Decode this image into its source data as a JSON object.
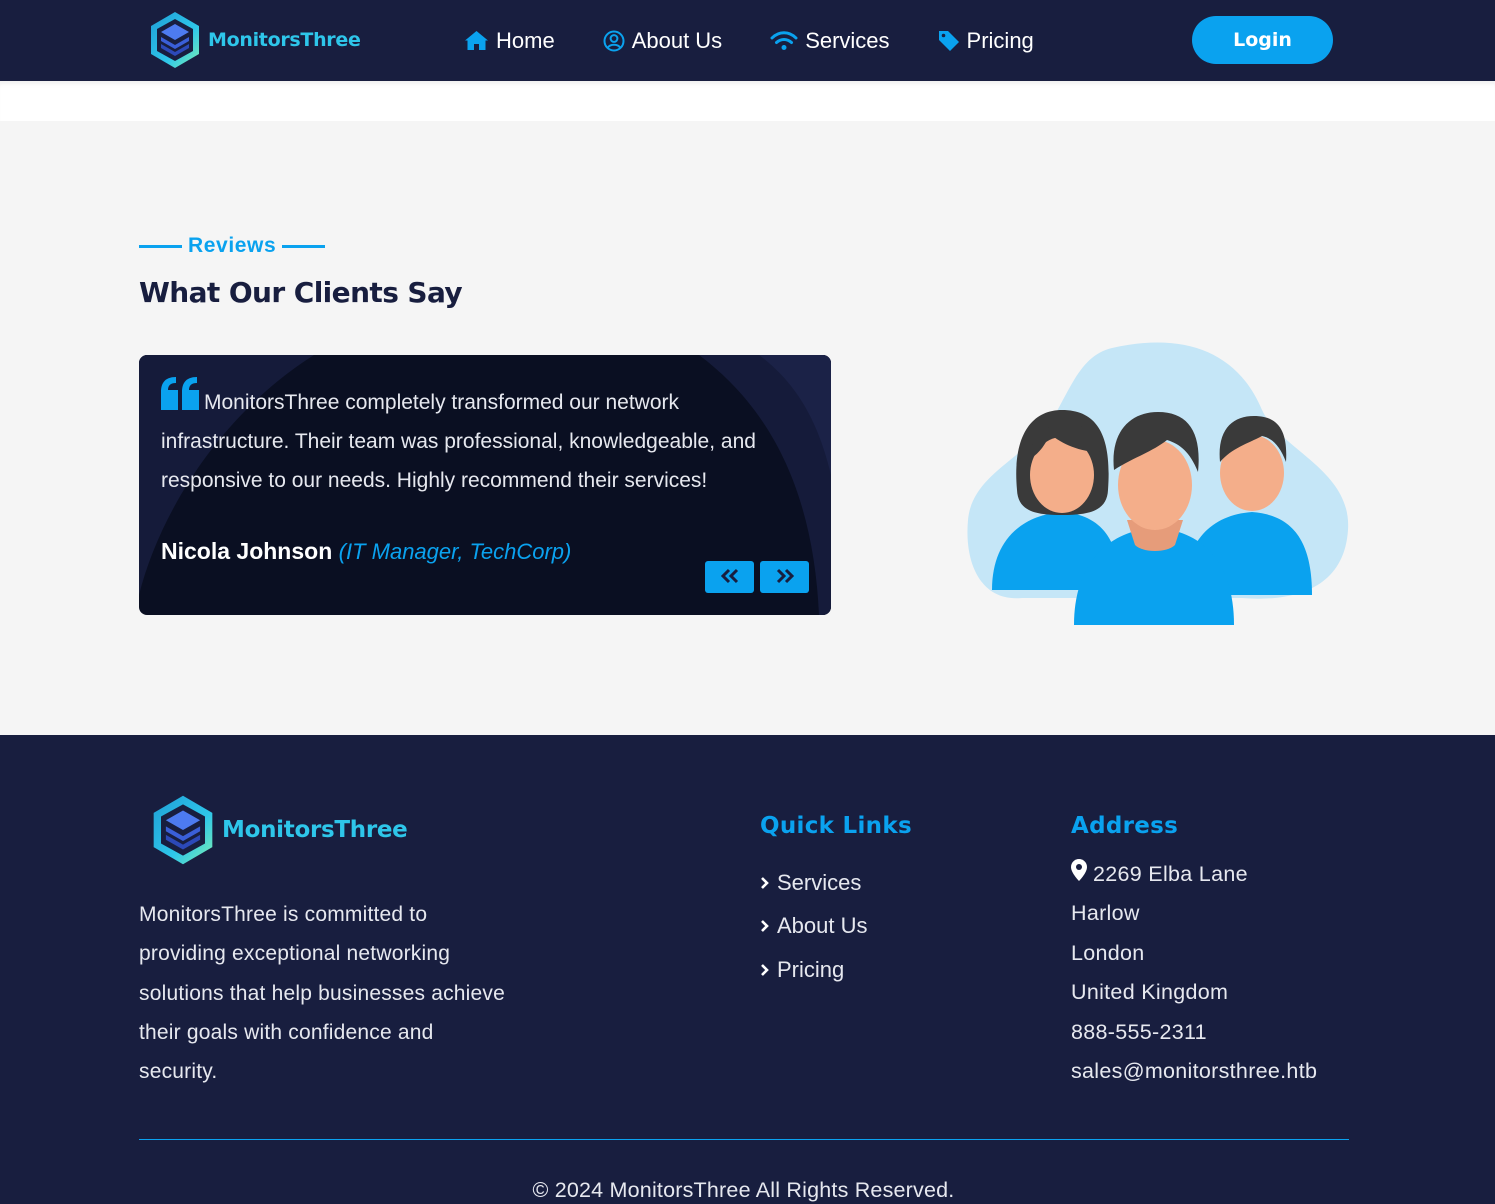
{
  "brand": {
    "name": "MonitorsThree",
    "accent": "#2ec6ea"
  },
  "colors": {
    "navy": "#181e3f",
    "blue": "#0aa2ef",
    "page_bg": "#f5f5f5"
  },
  "nav": {
    "items": [
      {
        "label": "Home",
        "icon": "home-icon"
      },
      {
        "label": "About Us",
        "icon": "user-circle-icon"
      },
      {
        "label": "Services",
        "icon": "wifi-icon"
      },
      {
        "label": "Pricing",
        "icon": "tag-icon"
      }
    ],
    "login_label": "Login"
  },
  "reviews": {
    "eyebrow": "Reviews",
    "title": "What Our Clients Say",
    "current": {
      "text": "MonitorsThree completely transformed our network infrastructure. Their team was professional, knowledgeable, and responsive to our needs. Highly recommend their services!",
      "name": "Nicola Johnson",
      "role": "(IT Manager, TechCorp)"
    },
    "prev_icon": "double-chevron-left-icon",
    "next_icon": "double-chevron-right-icon",
    "illustration": "clients-group-illustration"
  },
  "footer": {
    "description": "MonitorsThree is committed to providing exceptional networking solutions that help businesses achieve their goals with confidence and security.",
    "quick_links_title": "Quick Links",
    "quick_links": [
      "Services",
      "About Us",
      "Pricing"
    ],
    "address_title": "Address",
    "address": {
      "street": "2269 Elba Lane",
      "town": "Harlow",
      "city": "London",
      "country": "United Kingdom",
      "phone": "888-555-2311",
      "email": "sales@monitorsthree.htb"
    },
    "copyright": "© 2024 MonitorsThree All Rights Reserved."
  }
}
